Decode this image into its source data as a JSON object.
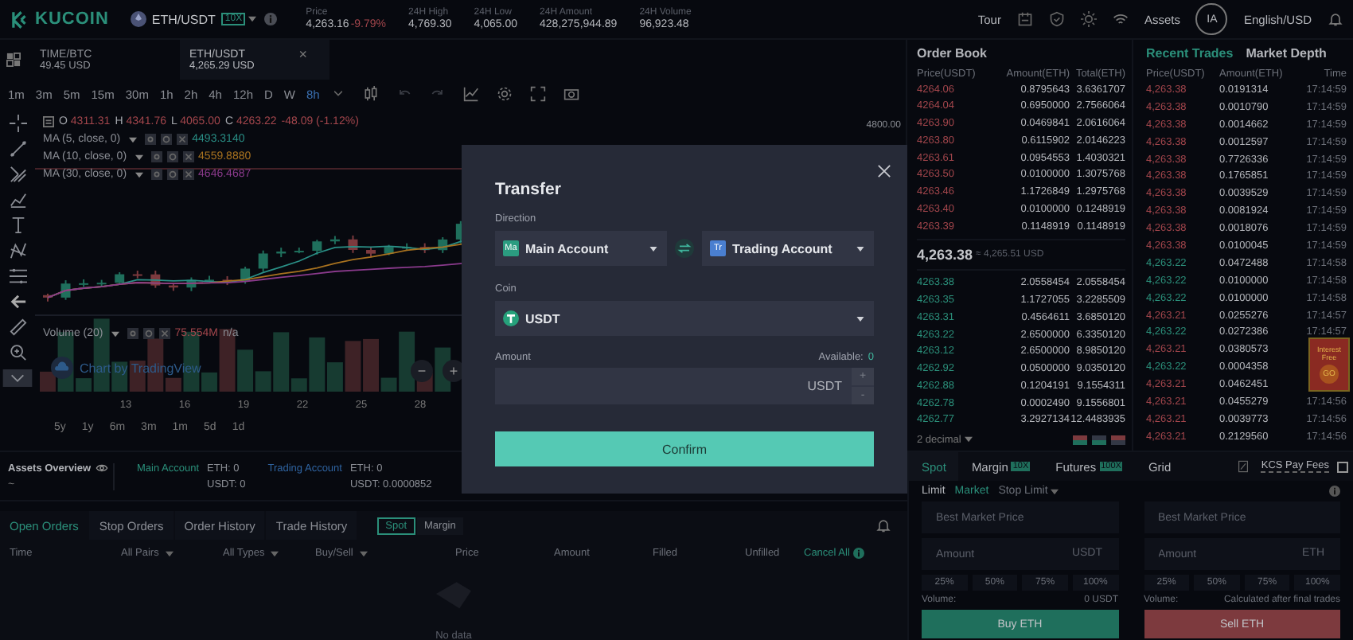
{
  "topbar": {
    "logo": "KUCOIN",
    "pair": "ETH/USDT",
    "leverage": "10X",
    "stats": [
      {
        "label": "Price",
        "value": "4,263.16",
        "change": "-9.79%"
      },
      {
        "label": "24H High",
        "value": "4,769.30"
      },
      {
        "label": "24H Low",
        "value": "4,065.00"
      },
      {
        "label": "24H Amount",
        "value": "428,275,944.89"
      },
      {
        "label": "24H Volume",
        "value": "96,923.48"
      }
    ],
    "tour": "Tour",
    "assets": "Assets",
    "avatar": "IA",
    "locale": "English/USD"
  },
  "chart_tabs": [
    {
      "pair": "TIME/BTC",
      "price": "49.45 USD",
      "selected": false
    },
    {
      "pair": "ETH/USDT",
      "price": "4,265.29 USD",
      "selected": true,
      "close": "×"
    }
  ],
  "intervals": [
    {
      "label": "1m",
      "selected": false
    },
    {
      "label": "3m",
      "selected": false
    },
    {
      "label": "5m",
      "selected": false
    },
    {
      "label": "15m",
      "selected": false
    },
    {
      "label": "30m",
      "selected": false
    },
    {
      "label": "1h",
      "selected": false
    },
    {
      "label": "2h",
      "selected": false
    },
    {
      "label": "4h",
      "selected": false
    },
    {
      "label": "12h",
      "selected": false
    },
    {
      "label": "D",
      "selected": false
    },
    {
      "label": "W",
      "selected": false
    },
    {
      "label": "8h",
      "selected": true
    }
  ],
  "legend": {
    "ohlc": [
      {
        "key": "O",
        "value": "4311.31"
      },
      {
        "key": "H",
        "value": "4341.76"
      },
      {
        "key": "L",
        "value": "4065.00"
      },
      {
        "key": "C",
        "value": "4263.22"
      }
    ],
    "change": "-48.09 (-1.12%)"
  },
  "mas": [
    {
      "label": "MA (5, close, 0)",
      "value": "4493.3140",
      "color": "#2a8f86"
    },
    {
      "label": "MA (10, close, 0)",
      "value": "4559.8880",
      "color": "#a8721f"
    },
    {
      "label": "MA (30, close, 0)",
      "value": "4646.4687",
      "color": "#8a3a8c"
    }
  ],
  "volume": {
    "label": "Volume (20)",
    "value": "75.554M",
    "extra": "n/a"
  },
  "attribution": "Chart by TradingView",
  "zoom_controls": [
    "−",
    "+"
  ],
  "price_label": "4800.00",
  "dates": [
    "13",
    "16",
    "19",
    "22",
    "25",
    "28"
  ],
  "ranges": [
    "5y",
    "1y",
    "6m",
    "3m",
    "1m",
    "5d",
    "1d"
  ],
  "assets_overview": {
    "title": "Assets Overview",
    "value": "~",
    "accounts": [
      {
        "name": "Main Account",
        "color": "#2a8f7a",
        "eth": "ETH: 0",
        "usdt": "USDT: 0"
      },
      {
        "name": "Trading Account",
        "color": "#2f63a0",
        "eth": "ETH: 0",
        "usdt": "USDT: 0.0000852"
      }
    ]
  },
  "order_tabs": [
    {
      "label": "Open Orders",
      "selected": true
    },
    {
      "label": "Stop Orders",
      "selected": false
    },
    {
      "label": "Order History",
      "selected": false
    },
    {
      "label": "Trade History",
      "selected": false
    }
  ],
  "market_tabs": [
    {
      "label": "Spot",
      "selected": true
    },
    {
      "label": "Margin",
      "selected": false
    }
  ],
  "order_columns": [
    {
      "label": "Time",
      "kind": "plain"
    },
    {
      "label": "All Pairs",
      "kind": "filter"
    },
    {
      "label": "All Types",
      "kind": "filter"
    },
    {
      "label": "Buy/Sell",
      "kind": "filter"
    },
    {
      "label": "Price",
      "kind": "plain"
    },
    {
      "label": "Amount",
      "kind": "plain"
    },
    {
      "label": "Filled",
      "kind": "plain"
    },
    {
      "label": "Unfilled",
      "kind": "plain"
    },
    {
      "label": "Cancel All",
      "kind": "action"
    }
  ],
  "empty_text": "No data",
  "order_book": {
    "title": "Order Book",
    "columns": [
      "Price(USDT)",
      "Amount(ETH)",
      "Total(ETH)"
    ],
    "asks": [
      {
        "price": "4264.06",
        "amount": "0.8795643",
        "total": "3.6361707"
      },
      {
        "price": "4264.04",
        "amount": "0.6950000",
        "total": "2.7566064"
      },
      {
        "price": "4263.90",
        "amount": "0.0469841",
        "total": "2.0616064"
      },
      {
        "price": "4263.80",
        "amount": "0.6115902",
        "total": "2.0146223"
      },
      {
        "price": "4263.61",
        "amount": "0.0954553",
        "total": "1.4030321"
      },
      {
        "price": "4263.50",
        "amount": "0.0100000",
        "total": "1.3075768"
      },
      {
        "price": "4263.46",
        "amount": "1.1726849",
        "total": "1.2975768"
      },
      {
        "price": "4263.40",
        "amount": "0.0100000",
        "total": "0.1248919"
      },
      {
        "price": "4263.39",
        "amount": "0.1148919",
        "total": "0.1148919"
      }
    ],
    "last_price": "4,263.38",
    "last_fiat": "≈ 4,265.51 USD",
    "bids": [
      {
        "price": "4263.38",
        "amount": "2.0558454",
        "total": "2.0558454"
      },
      {
        "price": "4263.35",
        "amount": "1.1727055",
        "total": "3.2285509"
      },
      {
        "price": "4263.31",
        "amount": "0.4564611",
        "total": "3.6850120"
      },
      {
        "price": "4263.22",
        "amount": "2.6500000",
        "total": "6.3350120"
      },
      {
        "price": "4263.12",
        "amount": "2.6500000",
        "total": "8.9850120"
      },
      {
        "price": "4262.92",
        "amount": "0.0500000",
        "total": "9.0350120"
      },
      {
        "price": "4262.88",
        "amount": "0.1204191",
        "total": "9.1554311"
      },
      {
        "price": "4262.78",
        "amount": "0.0002490",
        "total": "9.1556801"
      },
      {
        "price": "4262.77",
        "amount": "3.2927134",
        "total": "12.4483935"
      }
    ],
    "precision": "2 decimal"
  },
  "trade_tabs": [
    {
      "label": "Recent Trades",
      "selected": true
    },
    {
      "label": "Market Depth",
      "selected": false
    }
  ],
  "trade_columns": [
    "Price(USDT)",
    "Amount(ETH)",
    "Time"
  ],
  "trades": [
    {
      "price": "4,263.38",
      "amount": "0.0191314",
      "time": "17:14:59",
      "color": "#a3464c"
    },
    {
      "price": "4,263.38",
      "amount": "0.0010790",
      "time": "17:14:59",
      "color": "#a3464c"
    },
    {
      "price": "4,263.38",
      "amount": "0.0014662",
      "time": "17:14:59",
      "color": "#a3464c"
    },
    {
      "price": "4,263.38",
      "amount": "0.0012597",
      "time": "17:14:59",
      "color": "#a3464c"
    },
    {
      "price": "4,263.38",
      "amount": "0.7726336",
      "time": "17:14:59",
      "color": "#a3464c"
    },
    {
      "price": "4,263.38",
      "amount": "0.1765851",
      "time": "17:14:59",
      "color": "#a3464c"
    },
    {
      "price": "4,263.38",
      "amount": "0.0039529",
      "time": "17:14:59",
      "color": "#a3464c"
    },
    {
      "price": "4,263.38",
      "amount": "0.0081924",
      "time": "17:14:59",
      "color": "#a3464c"
    },
    {
      "price": "4,263.38",
      "amount": "0.0018076",
      "time": "17:14:59",
      "color": "#a3464c"
    },
    {
      "price": "4,263.38",
      "amount": "0.0100045",
      "time": "17:14:59",
      "color": "#a3464c"
    },
    {
      "price": "4,263.22",
      "amount": "0.0472488",
      "time": "17:14:58",
      "color": "#2b8f7a"
    },
    {
      "price": "4,263.22",
      "amount": "0.0100000",
      "time": "17:14:58",
      "color": "#2b8f7a"
    },
    {
      "price": "4,263.22",
      "amount": "0.0100000",
      "time": "17:14:58",
      "color": "#2b8f7a"
    },
    {
      "price": "4,263.21",
      "amount": "0.0255276",
      "time": "17:14:57",
      "color": "#a3464c"
    },
    {
      "price": "4,263.22",
      "amount": "0.0272386",
      "time": "17:14:57",
      "color": "#2b8f7a"
    },
    {
      "price": "4,263.21",
      "amount": "0.0380573",
      "color": "#a3464c"
    },
    {
      "price": "4,263.22",
      "amount": "0.0004358",
      "color": "#2b8f7a"
    },
    {
      "price": "4,263.21",
      "amount": "0.0462451",
      "color": "#a3464c"
    },
    {
      "price": "4,263.21",
      "amount": "0.0455279",
      "time": "17:14:56",
      "color": "#a3464c"
    },
    {
      "price": "4,263.21",
      "amount": "0.0039773",
      "time": "17:14:56",
      "color": "#a3464c"
    },
    {
      "price": "4,263.21",
      "amount": "0.2129560",
      "time": "17:14:56",
      "color": "#a3464c"
    }
  ],
  "promo": {
    "title": "Interest Free",
    "action": "GO"
  },
  "trade_panel": {
    "tabs": [
      {
        "label": "Spot",
        "selected": true
      },
      {
        "label": "Margin",
        "badge": "10X",
        "selected": false
      },
      {
        "label": "Futures",
        "badge": "100X",
        "selected": false
      },
      {
        "label": "Grid",
        "selected": false
      }
    ],
    "fee_toggle": {
      "label": "KCS Pay Fees",
      "checked": false
    },
    "order_types": [
      {
        "label": "Limit",
        "selected": false
      },
      {
        "label": "Market",
        "selected": true
      },
      {
        "label": "Stop Limit",
        "selected": false,
        "dropdown": true
      }
    ],
    "sides": [
      {
        "kind": "buy",
        "price_placeholder": "Best Market Price",
        "amount_placeholder": "Amount",
        "unit": "USDT",
        "percents": [
          "25%",
          "50%",
          "75%",
          "100%"
        ],
        "volume_label": "Volume:",
        "volume": "0 USDT",
        "button": "Buy ETH"
      },
      {
        "kind": "sell",
        "price_placeholder": "Best Market Price",
        "amount_placeholder": "Amount",
        "unit": "ETH",
        "percents": [
          "25%",
          "50%",
          "75%",
          "100%"
        ],
        "volume_label": "Volume:",
        "volume": "Calculated after final trades",
        "button": "Sell ETH"
      }
    ]
  },
  "modal": {
    "title": "Transfer",
    "direction_label": "Direction",
    "from": {
      "badge": "Ma",
      "name": "Main Account"
    },
    "to": {
      "badge": "Tr",
      "name": "Trading Account"
    },
    "coin_label": "Coin",
    "coin": "USDT",
    "amount_label": "Amount",
    "available_label": "Available:",
    "available": "0",
    "unit": "USDT",
    "step_up": "+",
    "step_down": "-",
    "confirm": "Confirm"
  }
}
